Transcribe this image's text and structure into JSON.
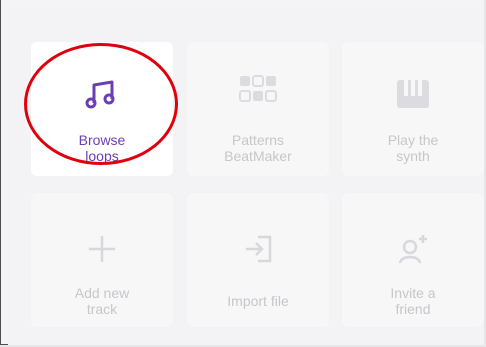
{
  "colors": {
    "accent": "#6a3fb3",
    "disabled": "#c7c7cb",
    "highlight": "#e0000d"
  },
  "tiles": [
    {
      "label": "Browse\nloops",
      "icon": "music-note-icon",
      "state": "active"
    },
    {
      "label": "Patterns\nBeatMaker",
      "icon": "patterns-grid-icon",
      "state": "disabled"
    },
    {
      "label": "Play the\nsynth",
      "icon": "piano-keys-icon",
      "state": "disabled"
    },
    {
      "label": "Add new\ntrack",
      "icon": "plus-icon",
      "state": "disabled"
    },
    {
      "label": "Import file",
      "icon": "import-icon",
      "state": "disabled"
    },
    {
      "label": "Invite a\nfriend",
      "icon": "add-person-icon",
      "state": "disabled"
    }
  ]
}
